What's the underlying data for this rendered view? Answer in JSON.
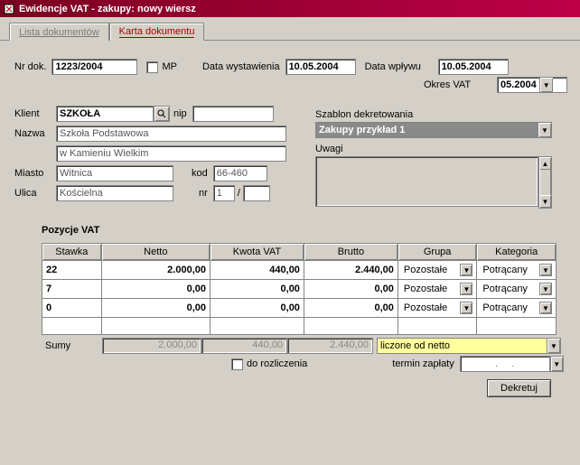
{
  "window": {
    "title": "Ewidencje VAT - zakupy: nowy wiersz"
  },
  "tabs": {
    "list": "Lista dokumentów",
    "card": "Karta dokumentu"
  },
  "top": {
    "nrdok_label": "Nr dok.",
    "nrdok": "1223/2004",
    "mp_label": "MP",
    "data_wyst_label": "Data wystawienia",
    "data_wyst": "10.05.2004",
    "data_wpl_label": "Data wpływu",
    "data_wpl": "10.05.2004",
    "okres_label": "Okres VAT",
    "okres": "05.2004"
  },
  "klient": {
    "label": "Klient",
    "value": "SZKOŁA",
    "nip_label": "nip",
    "nip": "",
    "nazwa_label": "Nazwa",
    "nazwa1": "Szkoła Podstawowa",
    "nazwa2": "w Kamieniu Wielkim",
    "miasto_label": "Miasto",
    "miasto": "Witnica",
    "kod_label": "kod",
    "kod": "66-460",
    "ulica_label": "Ulica",
    "ulica": "Kościelna",
    "nr_label": "nr",
    "nr1": "1",
    "nr_sep": "/",
    "nr2": ""
  },
  "szablon": {
    "label": "Szablon dekretowania",
    "value": "Zakupy przykład 1",
    "uwagi_label": "Uwagi",
    "uwagi": ""
  },
  "pozycje": {
    "title": "Pozycje VAT",
    "head": {
      "stawka": "Stawka",
      "netto": "Netto",
      "kwota": "Kwota VAT",
      "brutto": "Brutto",
      "grupa": "Grupa",
      "kategoria": "Kategoria"
    },
    "rows": [
      {
        "stawka": "22",
        "netto": "2.000,00",
        "kwota": "440,00",
        "brutto": "2.440,00",
        "grupa": "Pozostałe",
        "kategoria": "Potrącany"
      },
      {
        "stawka": "7",
        "netto": "0,00",
        "kwota": "0,00",
        "brutto": "0,00",
        "grupa": "Pozostałe",
        "kategoria": "Potrącany"
      },
      {
        "stawka": "0",
        "netto": "0,00",
        "kwota": "0,00",
        "brutto": "0,00",
        "grupa": "Pozostałe",
        "kategoria": "Potrącany"
      }
    ],
    "sumy_label": "Sumy",
    "sumy": {
      "netto": "2.000,00",
      "kwota": "440,00",
      "brutto": "2.440,00"
    },
    "liczone": "liczone od netto",
    "do_rozliczenia": "do rozliczenia",
    "termin_label": "termin zapłaty",
    "termin": ".     ."
  },
  "footer": {
    "dekretuj": "Dekretuj"
  }
}
